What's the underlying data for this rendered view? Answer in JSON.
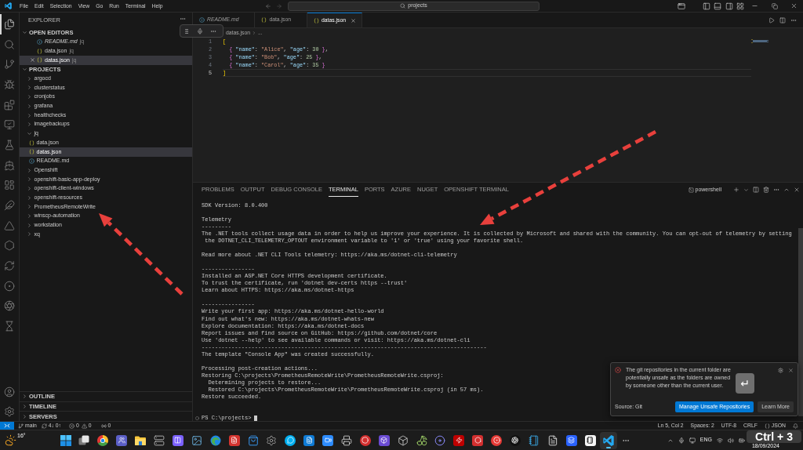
{
  "title_bar": {
    "menu": [
      "File",
      "Edit",
      "Selection",
      "View",
      "Go",
      "Run",
      "Terminal",
      "Help"
    ],
    "command_center": "projects"
  },
  "activity_bar": {
    "items": [
      {
        "selected": true
      },
      {
        "selected": false
      },
      {
        "selected": false
      },
      {
        "selected": false
      },
      {
        "selected": false
      },
      {
        "selected": false
      },
      {
        "selected": false
      },
      {
        "selected": false
      },
      {
        "selected": false
      },
      {
        "selected": false
      },
      {
        "selected": false
      },
      {
        "selected": false
      },
      {
        "selected": false
      },
      {
        "selected": false
      },
      {
        "selected": false
      },
      {
        "selected": false
      }
    ]
  },
  "sidebar": {
    "title": "EXPLORER",
    "open_editors": {
      "title": "OPEN EDITORS",
      "expanded": true,
      "items": [
        {
          "label": "README.md",
          "description": "jq",
          "kind": "markdown",
          "preview": true,
          "selected": false
        },
        {
          "label": "data.json",
          "description": "jq",
          "kind": "json",
          "preview": false,
          "selected": false
        },
        {
          "label": "datas.json",
          "description": "jq",
          "kind": "json",
          "preview": false,
          "selected": true
        }
      ]
    },
    "projects": {
      "title": "PROJECTS",
      "expanded": true,
      "items": [
        {
          "label": "argocd",
          "kind": "folder",
          "expanded": false,
          "selected": false
        },
        {
          "label": "clusterstatus",
          "kind": "folder",
          "expanded": false,
          "selected": false
        },
        {
          "label": "cronjobs",
          "kind": "folder",
          "expanded": false,
          "selected": false
        },
        {
          "label": "grafana",
          "kind": "folder",
          "expanded": false,
          "selected": false
        },
        {
          "label": "healthchecks",
          "kind": "folder",
          "expanded": false,
          "selected": false
        },
        {
          "label": "imagebackups",
          "kind": "folder",
          "expanded": false,
          "selected": false
        },
        {
          "label": "jq",
          "kind": "folder",
          "expanded": true,
          "selected": false,
          "children": [
            {
              "label": "data.json",
              "kind": "json",
              "selected": false
            },
            {
              "label": "datas.json",
              "kind": "json",
              "selected": true
            },
            {
              "label": "README.md",
              "kind": "markdown",
              "selected": false
            }
          ]
        },
        {
          "label": "Openshift",
          "kind": "folder",
          "expanded": false,
          "selected": false
        },
        {
          "label": "openshift-basic-app-deploy",
          "kind": "folder",
          "expanded": false,
          "selected": false
        },
        {
          "label": "openshift-client-windows",
          "kind": "folder",
          "expanded": false,
          "selected": false
        },
        {
          "label": "openshift-resources",
          "kind": "folder",
          "expanded": false,
          "selected": false
        },
        {
          "label": "PrometheusRemoteWrite",
          "kind": "folder",
          "expanded": false,
          "selected": false
        },
        {
          "label": "winscp-automation",
          "kind": "folder",
          "expanded": false,
          "selected": false
        },
        {
          "label": "workstation",
          "kind": "folder",
          "expanded": false,
          "selected": false
        },
        {
          "label": "xq",
          "kind": "folder",
          "expanded": false,
          "selected": false
        }
      ]
    },
    "collapsed_sections": [
      {
        "title": "OUTLINE",
        "expanded": false
      },
      {
        "title": "TIMELINE",
        "expanded": false
      },
      {
        "title": "SERVERS",
        "expanded": false
      }
    ]
  },
  "editor": {
    "tabs": [
      {
        "label": "README.md",
        "kind": "markdown",
        "preview": true,
        "selected": false
      },
      {
        "label": "data.json",
        "kind": "json",
        "preview": false,
        "selected": false
      },
      {
        "label": "datas.json",
        "kind": "json",
        "preview": false,
        "selected": true
      }
    ],
    "breadcrumb": [
      "datas.json",
      "..."
    ],
    "lines": [
      {
        "number": "1",
        "text": "[",
        "current": false
      },
      {
        "number": "2",
        "text": "  { \"name\": \"Alice\", \"age\": 30 },",
        "current": false
      },
      {
        "number": "3",
        "text": "  { \"name\": \"Bob\", \"age\": 25 },",
        "current": false
      },
      {
        "number": "4",
        "text": "  { \"name\": \"Carol\", \"age\": 35 }",
        "current": false
      },
      {
        "number": "5",
        "text": "]",
        "current": true
      }
    ]
  },
  "panel": {
    "tabs": [
      {
        "label": "PROBLEMS",
        "selected": false
      },
      {
        "label": "OUTPUT",
        "selected": false
      },
      {
        "label": "DEBUG CONSOLE",
        "selected": false
      },
      {
        "label": "TERMINAL",
        "selected": true
      },
      {
        "label": "PORTS",
        "selected": false
      },
      {
        "label": "AZURE",
        "selected": false
      },
      {
        "label": "NUGET",
        "selected": false
      },
      {
        "label": "OPENSHIFT TERMINAL",
        "selected": false
      }
    ],
    "terminal": {
      "name": "powershell",
      "blocks": [
        [
          "SDK Version: 8.0.400"
        ],
        [
          "Telemetry",
          "---------",
          "The .NET tools collect usage data in order to help us improve your experience. It is collected by Microsoft and shared with the community. You can opt-out of telemetry by setting",
          " the DOTNET_CLI_TELEMETRY_OPTOUT environment variable to '1' or 'true' using your favorite shell."
        ],
        [
          "Read more about .NET CLI Tools telemetry: https://aka.ms/dotnet-cli-telemetry"
        ],
        [
          "----------------",
          "Installed an ASP.NET Core HTTPS development certificate.",
          "To trust the certificate, run 'dotnet dev-certs https --trust'",
          "Learn about HTTPS: https://aka.ms/dotnet-https"
        ],
        [
          "----------------",
          "Write your first app: https://aka.ms/dotnet-hello-world",
          "Find out what's new: https://aka.ms/dotnet-whats-new",
          "Explore documentation: https://aka.ms/dotnet-docs",
          "Report issues and find source on GitHub: https://github.com/dotnet/core",
          "Use 'dotnet --help' to see available commands or visit: https://aka.ms/dotnet-cli",
          "--------------------------------------------------------------------------------------",
          "The template \"Console App\" was created successfully."
        ],
        [
          "Processing post-creation actions...",
          "Restoring C:\\projects\\PrometheusRemoteWrite\\PrometheusRemoteWrite.csproj:",
          "  Determining projects to restore...",
          "  Restored C:\\projects\\PrometheusRemoteWrite\\PrometheusRemoteWrite.csproj (in 57 ms).",
          "Restore succeeded."
        ]
      ],
      "prompt": "PS C:\\projects>"
    }
  },
  "notification": {
    "message": "The git repositories in the current folder are potentially unsafe as the folders are owned by someone other than the current user.",
    "source": "Source: Git",
    "buttons": [
      {
        "label": "Manage Unsafe Repositories",
        "primary": true
      },
      {
        "label": "Learn More",
        "primary": false
      }
    ]
  },
  "status_bar": {
    "branch": "main",
    "sync": "4↓ 0↑",
    "errors": "0",
    "warnings": "0",
    "ports": "0",
    "right": [
      "Ln 5, Col 2",
      "Spaces: 2",
      "UTF-8",
      "CRLF"
    ],
    "language": "JSON"
  },
  "taskbar": {
    "weather": "16°",
    "apps": [
      {
        "selected": false
      },
      {
        "selected": false
      },
      {
        "selected": false
      },
      {
        "selected": false
      },
      {
        "selected": false
      },
      {
        "selected": false
      },
      {
        "selected": false
      },
      {
        "selected": false
      },
      {
        "selected": false
      },
      {
        "selected": false
      },
      {
        "selected": false
      },
      {
        "selected": false
      },
      {
        "selected": false
      },
      {
        "selected": false
      },
      {
        "selected": false
      },
      {
        "selected": false
      },
      {
        "selected": false
      },
      {
        "selected": false
      },
      {
        "selected": false
      },
      {
        "selected": false
      },
      {
        "selected": false
      },
      {
        "selected": false
      },
      {
        "selected": false
      },
      {
        "selected": false
      },
      {
        "selected": false
      },
      {
        "selected": false
      },
      {
        "selected": false
      },
      {
        "selected": false
      },
      {
        "selected": false
      },
      {
        "selected": true
      }
    ],
    "language": "ENG",
    "date": "18/09/2024"
  },
  "key_overlays": [
    {
      "keys": "↵"
    },
    {
      "keys": "Ctrl + 3"
    }
  ]
}
